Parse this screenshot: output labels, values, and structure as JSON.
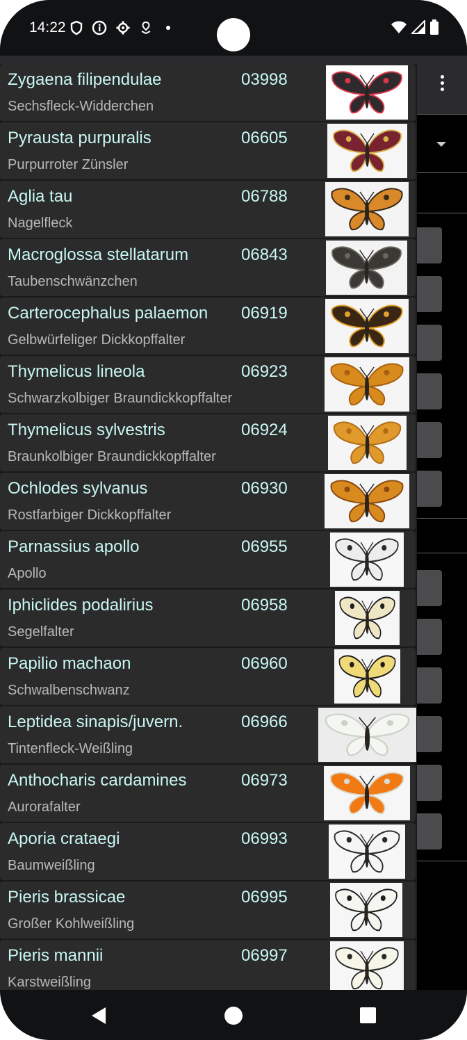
{
  "status_bar": {
    "time": "14:22",
    "left_icons": [
      "shield-icon",
      "info-icon",
      "settings-icon",
      "location-icon",
      "dot-icon"
    ],
    "right_icons": [
      "wifi-icon",
      "signal-icon",
      "battery-icon"
    ]
  },
  "list": {
    "items": [
      {
        "scientific_name": "Zygaena filipendulae",
        "code": "03998",
        "common_name": "Sechsfleck-Widderchen",
        "colors": [
          "#2e2a2e",
          "#d9384a"
        ],
        "bg": "#ffffff"
      },
      {
        "scientific_name": "Pyrausta purpuralis",
        "code": "06605",
        "common_name": "Purpurroter Zünsler",
        "colors": [
          "#7a2330",
          "#d8b24a"
        ],
        "bg": "#f6f6f6"
      },
      {
        "scientific_name": "Aglia tau",
        "code": "06788",
        "common_name": "Nagelfleck",
        "colors": [
          "#d9892a",
          "#3a2a18"
        ],
        "bg": "#f4f4f4"
      },
      {
        "scientific_name": "Macroglossa stellatarum",
        "code": "06843",
        "common_name": "Taubenschwänzchen",
        "colors": [
          "#3a3936",
          "#6a655c"
        ],
        "bg": "#f3f3f3"
      },
      {
        "scientific_name": "Carterocephalus palaemon",
        "code": "06919",
        "common_name": "Gelbwürfeliger Dickkopffalter",
        "colors": [
          "#3a2614",
          "#e0a02a"
        ],
        "bg": "#f5f5f5"
      },
      {
        "scientific_name": "Thymelicus lineola",
        "code": "06923",
        "common_name": "Schwarzkolbiger Braundickkopffalter",
        "colors": [
          "#d98a1c",
          "#a86010"
        ],
        "bg": "#f5f5f5"
      },
      {
        "scientific_name": "Thymelicus sylvestris",
        "code": "06924",
        "common_name": "Braunkolbiger Braundickkopffalter",
        "colors": [
          "#e09a2c",
          "#b06c14"
        ],
        "bg": "#f5f5f5"
      },
      {
        "scientific_name": "Ochlodes sylvanus",
        "code": "06930",
        "common_name": "Rostfarbiger Dickkopffalter",
        "colors": [
          "#d98a1e",
          "#8a4a10"
        ],
        "bg": "#f5f5f5"
      },
      {
        "scientific_name": "Parnassius apollo",
        "code": "06955",
        "common_name": "Apollo",
        "colors": [
          "#ededed",
          "#2a2a2a"
        ],
        "bg": "#f7f7f7"
      },
      {
        "scientific_name": "Iphiclides podalirius",
        "code": "06958",
        "common_name": "Segelfalter",
        "colors": [
          "#efe6c4",
          "#1e1e1e"
        ],
        "bg": "#f6f6f6"
      },
      {
        "scientific_name": "Papilio machaon",
        "code": "06960",
        "common_name": "Schwalbenschwanz",
        "colors": [
          "#f0d977",
          "#1b1b1b"
        ],
        "bg": "#f6f6f6"
      },
      {
        "scientific_name": "Leptidea sinapis/juvern.",
        "code": "06966",
        "common_name": "Tintenfleck-Weißling",
        "colors": [
          "#f4f6f2",
          "#c9d2c4"
        ],
        "bg": "#ececec"
      },
      {
        "scientific_name": "Anthocharis cardamines",
        "code": "06973",
        "common_name": "Aurorafalter",
        "colors": [
          "#f27a14",
          "#d9dccf"
        ],
        "bg": "#f6f6f6"
      },
      {
        "scientific_name": "Aporia crataegi",
        "code": "06993",
        "common_name": "Baumweißling",
        "colors": [
          "#f5f5f5",
          "#2a2a2a"
        ],
        "bg": "#f7f7f7"
      },
      {
        "scientific_name": "Pieris brassicae",
        "code": "06995",
        "common_name": "Großer Kohlweißling",
        "colors": [
          "#f6f6f0",
          "#1e1e1e"
        ],
        "bg": "#f6f6f6"
      },
      {
        "scientific_name": "Pieris mannii",
        "code": "06997",
        "common_name": "Karstweißling",
        "colors": [
          "#f6f6e8",
          "#2a2a2a"
        ],
        "bg": "#f6f6f6"
      }
    ]
  },
  "nav_bar": {
    "icons": [
      "back-icon",
      "home-icon",
      "recents-icon"
    ]
  }
}
